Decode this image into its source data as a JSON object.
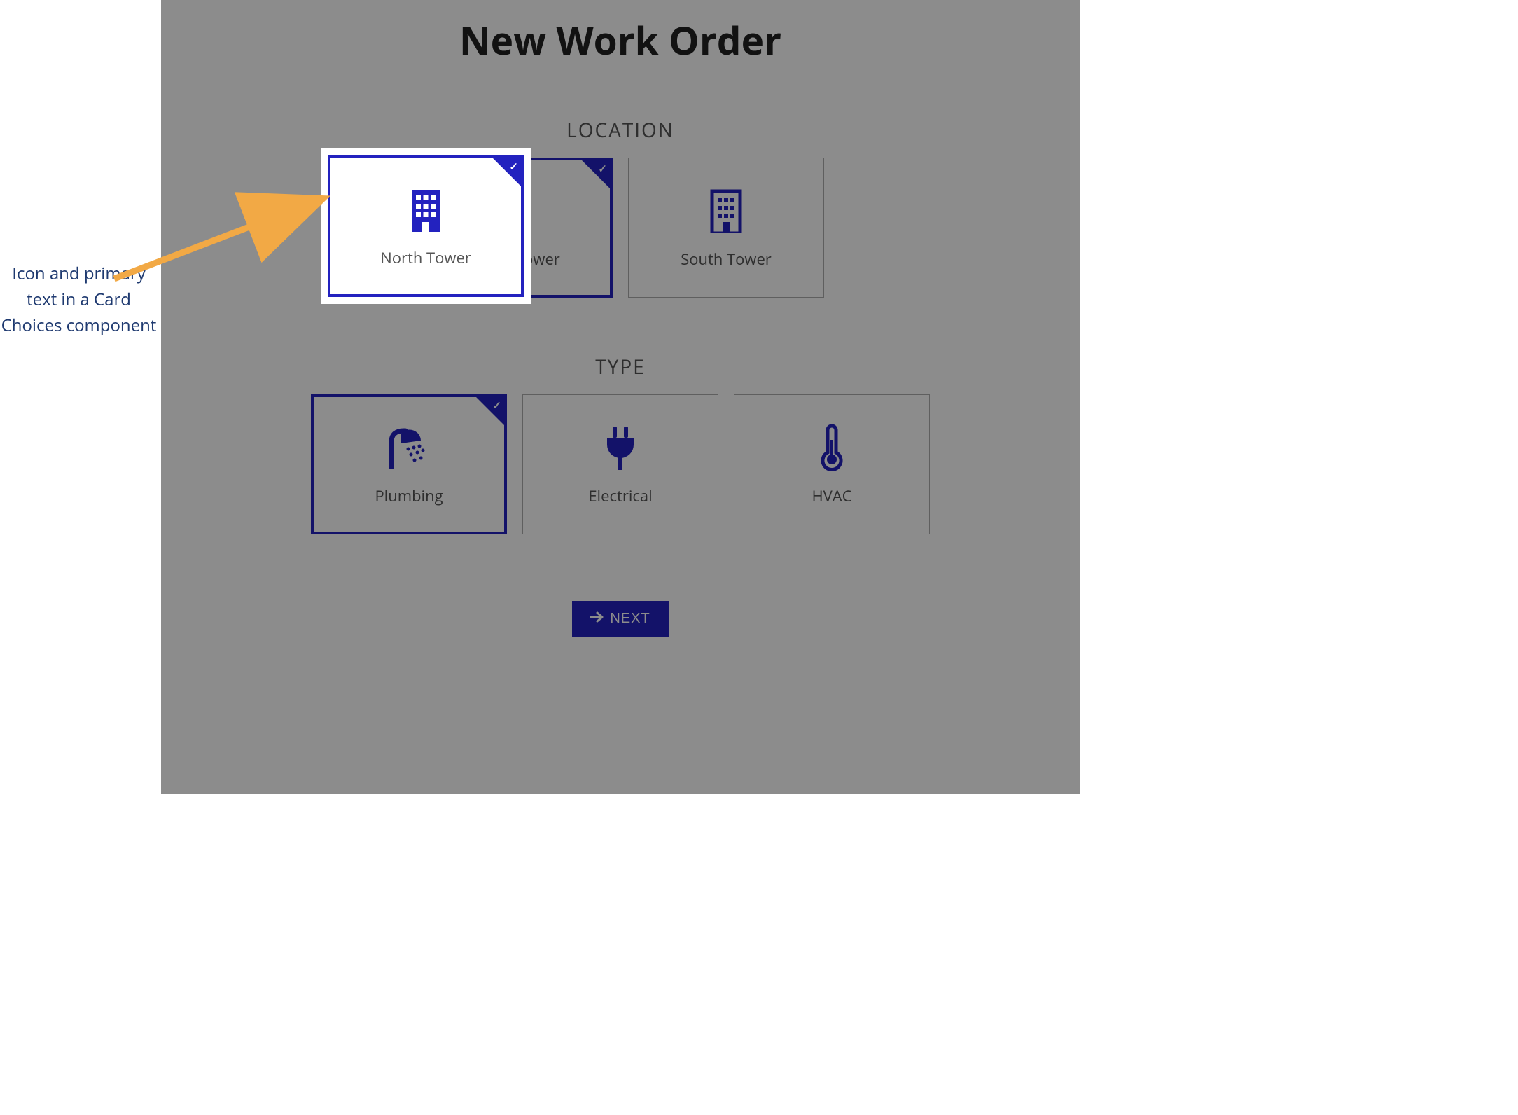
{
  "callout": "Icon and primary text in a Card Choices component",
  "page_title": "New Work Order",
  "accent_color": "#2322bf",
  "sections": {
    "location": {
      "header": "LOCATION",
      "cards": [
        {
          "label": "North Tower",
          "icon": "building-icon",
          "selected": true
        },
        {
          "label": "South Tower",
          "icon": "building-icon",
          "selected": false
        }
      ]
    },
    "type": {
      "header": "TYPE",
      "cards": [
        {
          "label": "Plumbing",
          "icon": "shower-icon",
          "selected": true
        },
        {
          "label": "Electrical",
          "icon": "plug-icon",
          "selected": false
        },
        {
          "label": "HVAC",
          "icon": "thermometer-icon",
          "selected": false
        }
      ]
    }
  },
  "next_label": "NEXT"
}
